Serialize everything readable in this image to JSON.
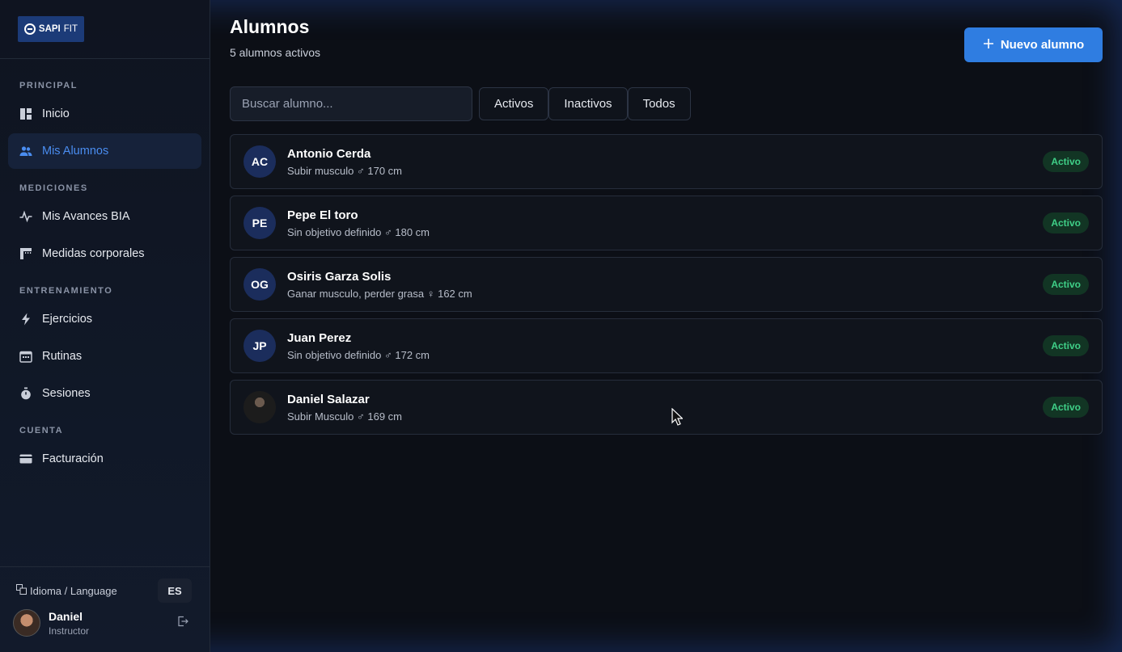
{
  "brand": {
    "logo_main": "SAPI",
    "logo_sub": "FIT"
  },
  "sidebar": {
    "sections": [
      {
        "label": "PRINCIPAL",
        "items": [
          {
            "label": "Inicio",
            "icon": "dashboard-icon"
          },
          {
            "label": "Mis Alumnos",
            "icon": "users-icon",
            "active": true
          }
        ]
      },
      {
        "label": "MEDICIONES",
        "items": [
          {
            "label": "Mis Avances BIA",
            "icon": "activity-icon"
          },
          {
            "label": "Medidas corporales",
            "icon": "ruler-icon"
          }
        ]
      },
      {
        "label": "ENTRENAMIENTO",
        "items": [
          {
            "label": "Ejercicios",
            "icon": "bolt-icon"
          },
          {
            "label": "Rutinas",
            "icon": "calendar-icon"
          },
          {
            "label": "Sesiones",
            "icon": "stopwatch-icon"
          }
        ]
      },
      {
        "label": "CUENTA",
        "items": [
          {
            "label": "Facturación",
            "icon": "card-icon"
          }
        ]
      }
    ],
    "language_label": "Idioma / Language",
    "language_value": "ES",
    "user": {
      "name": "Daniel",
      "role": "Instructor"
    }
  },
  "header": {
    "title": "Alumnos",
    "subtitle": "5 alumnos activos",
    "new_button": "Nuevo alumno"
  },
  "search": {
    "placeholder": "Buscar alumno..."
  },
  "filters": [
    "Activos",
    "Inactivos",
    "Todos"
  ],
  "students": [
    {
      "initials": "AC",
      "name": "Antonio Cerda",
      "goal": "Subir musculo",
      "sex": "♂",
      "height": "170 cm",
      "status": "Activo"
    },
    {
      "initials": "PE",
      "name": "Pepe El toro",
      "goal": "Sin objetivo definido",
      "sex": "♂",
      "height": "180 cm",
      "status": "Activo"
    },
    {
      "initials": "OG",
      "name": "Osiris Garza Solis",
      "goal": "Ganar musculo, perder grasa",
      "sex": "♀",
      "height": "162 cm",
      "status": "Activo"
    },
    {
      "initials": "JP",
      "name": "Juan Perez",
      "goal": "Sin objetivo definido",
      "sex": "♂",
      "height": "172 cm",
      "status": "Activo"
    },
    {
      "initials": "",
      "name": "Daniel Salazar",
      "goal": "Subir Musculo",
      "sex": "♂",
      "height": "169 cm",
      "status": "Activo",
      "photo": true
    }
  ],
  "colors": {
    "accent": "#2f7de1",
    "active_nav": "#4a8df0",
    "badge_bg": "#123524",
    "badge_text": "#3fcf87"
  }
}
